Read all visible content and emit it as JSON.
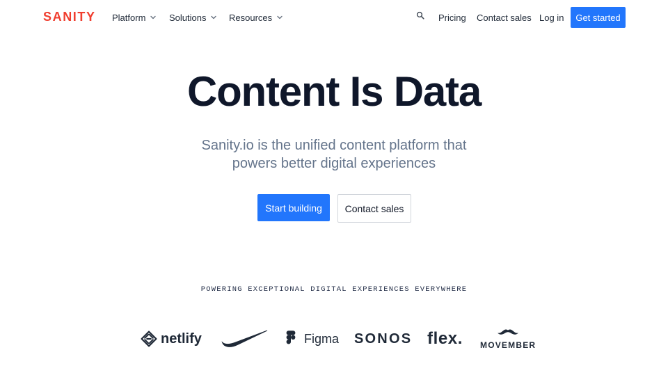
{
  "brand": {
    "name": "SANITY"
  },
  "nav": {
    "menus": [
      {
        "label": "Platform"
      },
      {
        "label": "Solutions"
      },
      {
        "label": "Resources"
      }
    ],
    "right_links": [
      {
        "label": "Pricing"
      },
      {
        "label": "Contact sales"
      },
      {
        "label": "Log in"
      }
    ],
    "cta_label": "Get started"
  },
  "hero": {
    "title": "Content Is Data",
    "subtitle_lines": [
      "Sanity.io is the unified content platform that",
      "powers better digital experiences"
    ],
    "primary_cta": "Start building",
    "secondary_cta": "Contact sales",
    "powering_text": "POWERING EXCEPTIONAL DIGITAL EXPERIENCES EVERYWHERE"
  },
  "logos": [
    {
      "name": "netlify",
      "icon": "netlify-icon"
    },
    {
      "name": "",
      "icon": "nike-swoosh-icon"
    },
    {
      "name": "Figma",
      "icon": "figma-icon"
    },
    {
      "name": "SONOS",
      "icon": ""
    },
    {
      "name": "flex.",
      "icon": ""
    },
    {
      "name": "MOVEMBER",
      "icon": "movember-mustache-icon"
    }
  ],
  "colors": {
    "brand_red": "#f03e2f",
    "primary_blue": "#2276fc",
    "text_dark": "#0f172a",
    "text_muted": "#64748b"
  }
}
